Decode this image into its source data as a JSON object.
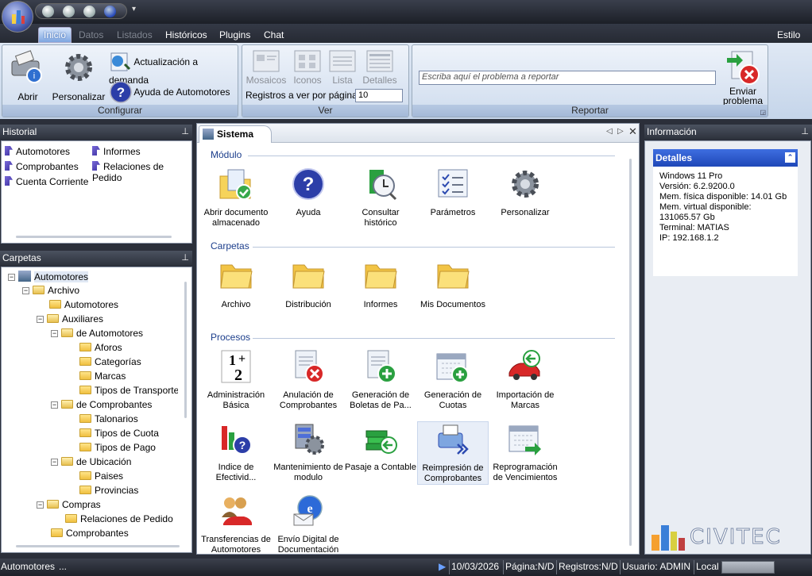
{
  "titlebar": {
    "more_glyph": "▾"
  },
  "tabs": [
    {
      "label": "Inicio",
      "state": "active"
    },
    {
      "label": "Datos",
      "state": "disabled"
    },
    {
      "label": "Listados",
      "state": "disabled"
    },
    {
      "label": "Históricos",
      "state": "normal"
    },
    {
      "label": "Plugins",
      "state": "normal"
    },
    {
      "label": "Chat",
      "state": "normal"
    }
  ],
  "style_menu": "Estilo",
  "ribbon": {
    "configurar": {
      "label": "Configurar",
      "abrir": "Abrir",
      "personalizar": "Personalizar",
      "actualizacion": "Actualización a demanda",
      "ayuda": "Ayuda de Automotores"
    },
    "ver": {
      "label": "Ver",
      "mosaicos": "Mosaicos",
      "iconos": "Iconos",
      "lista": "Lista",
      "detalles": "Detalles",
      "registros_label": "Registros a ver por página:",
      "registros_value": "10"
    },
    "reportar": {
      "label": "Reportar",
      "placeholder": "Escriba aquí el problema a reportar",
      "enviar": "Enviar problema"
    }
  },
  "historial": {
    "title": "Historial",
    "items": [
      "Automotores",
      "Informes",
      "Comprobantes",
      "Relaciones de Pedido",
      "Cuenta Corriente"
    ]
  },
  "carpetas": {
    "title": "Carpetas",
    "nodes": [
      {
        "label": "Automotores",
        "exp": "−"
      },
      {
        "label": "Archivo",
        "exp": "−"
      },
      {
        "label": "Automotores",
        "exp": ""
      },
      {
        "label": "Auxiliares",
        "exp": "−"
      },
      {
        "label": "de Automotores",
        "exp": "−"
      },
      {
        "label": "Aforos",
        "exp": ""
      },
      {
        "label": "Categorías",
        "exp": ""
      },
      {
        "label": "Marcas",
        "exp": ""
      },
      {
        "label": "Tipos de Transporte",
        "exp": ""
      },
      {
        "label": "de Comprobantes",
        "exp": "−"
      },
      {
        "label": "Talonarios",
        "exp": ""
      },
      {
        "label": "Tipos de Cuota",
        "exp": ""
      },
      {
        "label": "Tipos de Pago",
        "exp": ""
      },
      {
        "label": "de Ubicación",
        "exp": "−"
      },
      {
        "label": "Paises",
        "exp": ""
      },
      {
        "label": "Provincias",
        "exp": ""
      },
      {
        "label": "Compras",
        "exp": "−"
      },
      {
        "label": "Relaciones de Pedido",
        "exp": ""
      },
      {
        "label": "Comprobantes",
        "exp": ""
      }
    ]
  },
  "main": {
    "tab_title": "Sistema",
    "modulo": {
      "title": "Módulo",
      "items": [
        "Abrir documento almacenado",
        "Ayuda",
        "Consultar histórico",
        "Parámetros",
        "Personalizar"
      ]
    },
    "carpetas": {
      "title": "Carpetas",
      "items": [
        "Archivo",
        "Distribución",
        "Informes",
        "Mis Documentos"
      ]
    },
    "procesos": {
      "title": "Procesos",
      "items": [
        "Administración Básica",
        "Anulación de Comprobantes",
        "Generación de Boletas de Pa...",
        "Generación de Cuotas",
        "Importación de Marcas",
        "Indice de Efectivid...",
        "Mantenimiento de modulo",
        "Pasaje a Contable",
        "Reimpresión de Comprobantes",
        "Reprogramación de Vencimientos",
        "Transferencias de Automotores",
        "Envío Digital de Documentación"
      ]
    }
  },
  "informacion": {
    "title": "Información",
    "detalles_title": "Detalles",
    "lines": [
      "Windows 11 Pro",
      "Versión: 6.2.9200.0",
      "Mem. física disponible: 14.01 Gb",
      "Mem. virtual disponible:",
      "131065.57 Gb",
      "Terminal: MATIAS",
      "IP: 192.168.1.2"
    ],
    "logo_text": "CIVITEC"
  },
  "status": {
    "module": "Automotores",
    "ellipsis": "...",
    "date": "10/03/2026",
    "pagina": "Página:N/D",
    "registros": "Registros:N/D",
    "usuario": "Usuario: ADMIN",
    "local": "Local"
  }
}
